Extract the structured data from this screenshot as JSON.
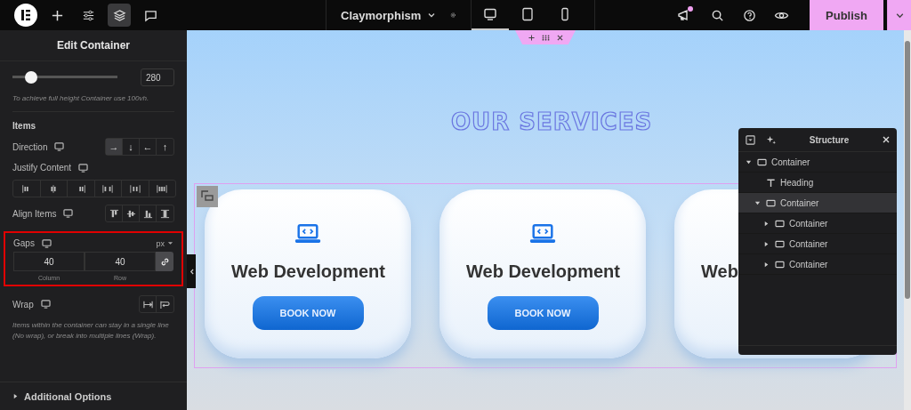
{
  "topbar": {
    "tools": [
      {
        "kind": "plus",
        "selected": false
      },
      {
        "kind": "sliders",
        "selected": false
      },
      {
        "kind": "layers",
        "selected": true
      },
      {
        "kind": "chat",
        "selected": false
      }
    ],
    "page_title": "Claymorphism",
    "devices": [
      {
        "kind": "desktop",
        "selected": true
      },
      {
        "kind": "tablet",
        "selected": false
      },
      {
        "kind": "mobile",
        "selected": false
      }
    ],
    "notification": true,
    "publish": "Publish"
  },
  "panel": {
    "title": "Edit Container",
    "min_height": {
      "level": 0.18,
      "value": "280",
      "hint": "To achieve full height Container use 100vh."
    },
    "section": "Items",
    "direction": {
      "label": "Direction",
      "options": [
        {
          "glyph": "→",
          "selected": true
        },
        {
          "glyph": "↓",
          "selected": false
        },
        {
          "glyph": "←",
          "selected": false
        },
        {
          "glyph": "↑",
          "selected": false
        }
      ]
    },
    "justify": {
      "label": "Justify Content",
      "options": [
        {
          "kind": "start"
        },
        {
          "kind": "center"
        },
        {
          "kind": "end"
        },
        {
          "kind": "between"
        },
        {
          "kind": "around"
        },
        {
          "kind": "evenly"
        }
      ]
    },
    "align": {
      "label": "Align Items",
      "options": [
        {
          "kind": "top"
        },
        {
          "kind": "middle"
        },
        {
          "kind": "bottom"
        },
        {
          "kind": "stretch"
        }
      ]
    },
    "gaps": {
      "label": "Gaps",
      "unit": "px",
      "column": "40",
      "row": "40",
      "column_label": "Column",
      "row_label": "Row",
      "linked": true,
      "highlighted": true
    },
    "wrap": {
      "label": "Wrap",
      "options": [
        {
          "kind": "nowrap"
        },
        {
          "kind": "wrap"
        }
      ],
      "note": "Items within the container can stay in a single line (No wrap), or break into multiple lines (Wrap)."
    },
    "additional": "Additional Options"
  },
  "canvas": {
    "heading": "OUR SERVICES",
    "cards": [
      {
        "title": "Web Development",
        "button": "BOOK NOW"
      },
      {
        "title": "Web Development",
        "button": "BOOK NOW"
      },
      {
        "title": "Web"
      }
    ]
  },
  "structure": {
    "title": "Structure",
    "tree": [
      {
        "label": "Container",
        "kind": "container",
        "expanded": true,
        "selected": false,
        "children": [
          {
            "label": "Heading",
            "kind": "heading",
            "selected": false
          },
          {
            "label": "Container",
            "kind": "container",
            "expanded": true,
            "selected": true,
            "children": [
              {
                "label": "Container",
                "kind": "container",
                "expanded": false,
                "selected": false
              },
              {
                "label": "Container",
                "kind": "container",
                "expanded": false,
                "selected": false
              },
              {
                "label": "Container",
                "kind": "container",
                "expanded": false,
                "selected": false
              }
            ]
          }
        ]
      }
    ]
  }
}
